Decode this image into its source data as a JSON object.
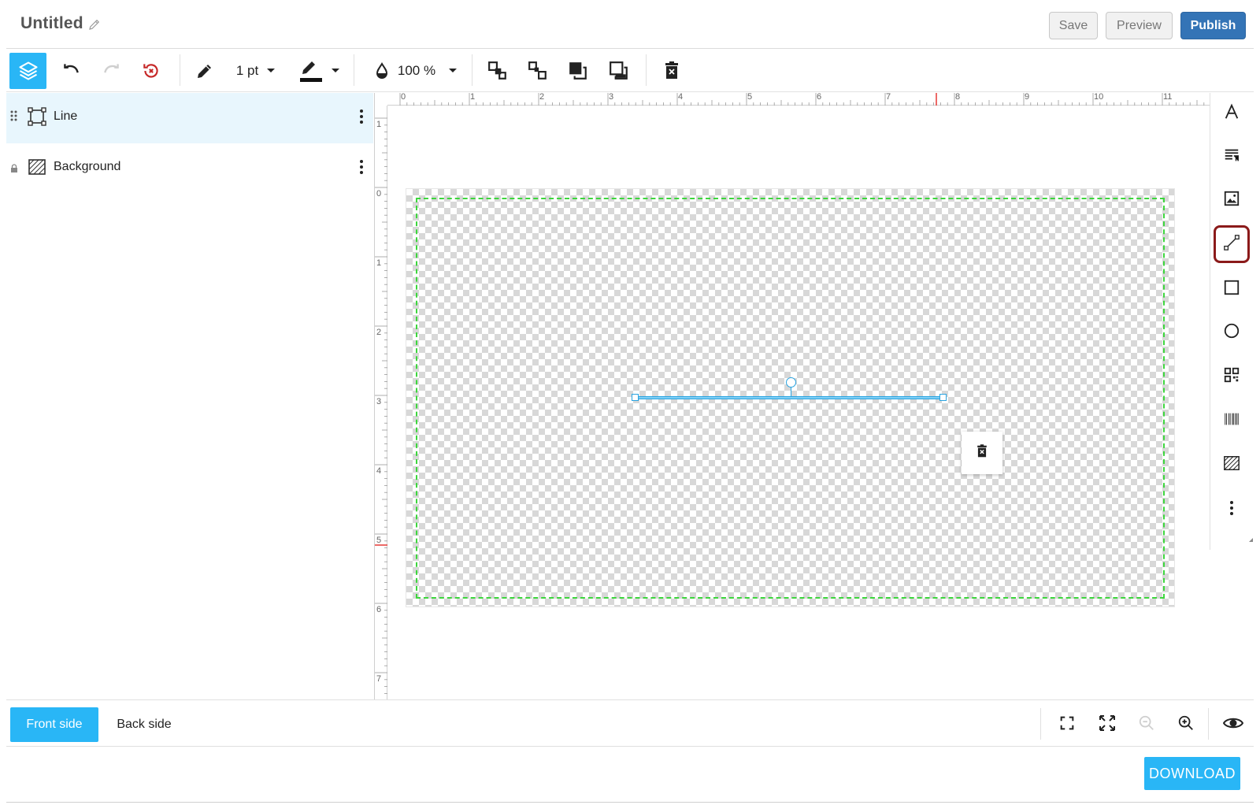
{
  "header": {
    "title": "Untitled",
    "save_label": "Save",
    "preview_label": "Preview",
    "publish_label": "Publish"
  },
  "toolbar": {
    "stroke_width": "1 pt",
    "opacity": "100 %",
    "icons": [
      "layers-icon",
      "undo-icon",
      "redo-icon",
      "reset-icon",
      "pencil-icon",
      "stroke-width-dropdown",
      "stroke-color-icon",
      "opacity-icon",
      "bring-forward-icon",
      "send-backward-icon",
      "bring-to-front-icon",
      "send-to-back-icon",
      "delete-icon"
    ]
  },
  "layers": {
    "items": [
      {
        "label": "Line",
        "icon": "shape-icon",
        "active": true
      },
      {
        "label": "Background",
        "icon": "background-icon",
        "locked": true
      }
    ]
  },
  "ruler": {
    "top": [
      "0",
      "1",
      "2",
      "3",
      "4",
      "5",
      "6",
      "7",
      "8",
      "9",
      "10",
      "11"
    ],
    "left": [
      "1",
      "0",
      "1",
      "2",
      "3",
      "4",
      "5",
      "6",
      "7"
    ]
  },
  "tools": [
    "text-icon",
    "paragraph-icon",
    "image-icon",
    "line-icon",
    "rectangle-icon",
    "ellipse-icon",
    "qr-code-icon",
    "barcode-icon",
    "background-icon",
    "more-icon"
  ],
  "bottom": {
    "front_label": "Front side",
    "back_label": "Back side"
  },
  "download_label": "DOWNLOAD",
  "colors": {
    "accent": "#29b6f6",
    "publish": "#3474b6",
    "safe_area": "#3dd63d",
    "selected_tool_border": "#8b1a1a",
    "reset_red": "#c62828"
  }
}
